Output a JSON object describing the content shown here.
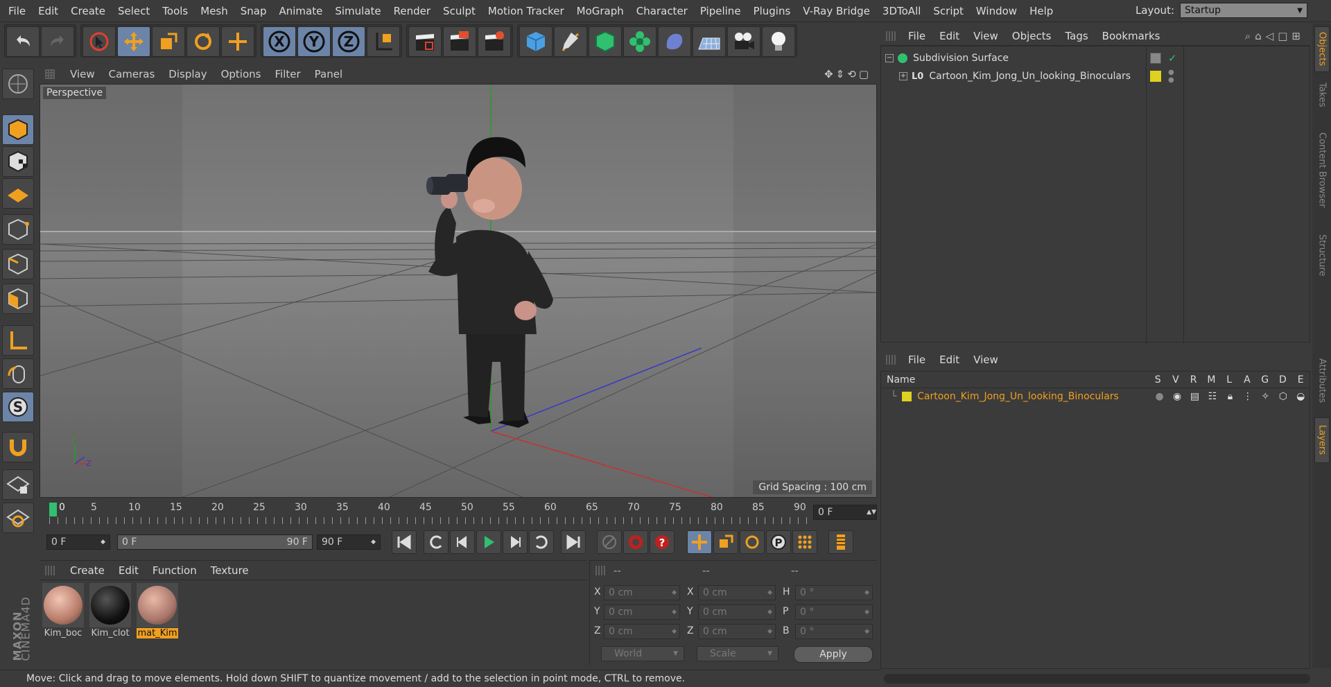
{
  "menu": [
    "File",
    "Edit",
    "Create",
    "Select",
    "Tools",
    "Mesh",
    "Snap",
    "Animate",
    "Simulate",
    "Render",
    "Sculpt",
    "Motion Tracker",
    "MoGraph",
    "Character",
    "Pipeline",
    "Plugins",
    "V-Ray Bridge",
    "3DToAll",
    "Script",
    "Window",
    "Help"
  ],
  "layout": {
    "label": "Layout:",
    "value": "Startup"
  },
  "viewport": {
    "menu": [
      "View",
      "Cameras",
      "Display",
      "Options",
      "Filter",
      "Panel"
    ],
    "camera": "Perspective",
    "grid_spacing": "Grid Spacing : 100 cm"
  },
  "axes": {
    "y": "Y",
    "z": "Z"
  },
  "timeline": {
    "ticks": [
      "0",
      "5",
      "10",
      "15",
      "20",
      "25",
      "30",
      "35",
      "40",
      "45",
      "50",
      "55",
      "60",
      "65",
      "70",
      "75",
      "80",
      "85",
      "90"
    ],
    "current": "0 F"
  },
  "transport": {
    "start": "0 F",
    "range_start": "0 F",
    "range_end": "90 F",
    "end": "90 F"
  },
  "materials": {
    "menu": [
      "Create",
      "Edit",
      "Function",
      "Texture"
    ],
    "items": [
      {
        "name": "Kim_boc",
        "color": "#d9a28e"
      },
      {
        "name": "Kim_clot",
        "color": "#1a1a1a"
      },
      {
        "name": "mat_Kim",
        "color": "#c99582"
      }
    ]
  },
  "coordinates": {
    "headers": [
      "--",
      "--",
      "--"
    ],
    "rows": [
      {
        "l1": "X",
        "v1": "0 cm",
        "l2": "X",
        "v2": "0 cm",
        "l3": "H",
        "v3": "0 °"
      },
      {
        "l1": "Y",
        "v1": "0 cm",
        "l2": "Y",
        "v2": "0 cm",
        "l3": "P",
        "v3": "0 °"
      },
      {
        "l1": "Z",
        "v1": "0 cm",
        "l2": "Z",
        "v2": "0 cm",
        "l3": "B",
        "v3": "0 °"
      }
    ],
    "mode": "World",
    "scale": "Scale",
    "apply": "Apply"
  },
  "status": "Move: Click and drag to move elements. Hold down SHIFT to quantize movement / add to the selection in point mode, CTRL to remove.",
  "logo": {
    "brand": "MAXON",
    "product": "CINEMA4D"
  },
  "objects": {
    "menu": [
      "File",
      "Edit",
      "View",
      "Objects",
      "Tags",
      "Bookmarks"
    ],
    "items": [
      {
        "name": "Subdivision Surface"
      },
      {
        "name": "Cartoon_Kim_Jong_Un_looking_Binoculars",
        "layer": "L0"
      }
    ]
  },
  "layers": {
    "menu": [
      "File",
      "Edit",
      "View"
    ],
    "columns": {
      "name": "Name",
      "flags": [
        "S",
        "V",
        "R",
        "M",
        "L",
        "A",
        "G",
        "D",
        "E"
      ]
    },
    "items": [
      {
        "name": "Cartoon_Kim_Jong_Un_looking_Binoculars"
      }
    ]
  },
  "side_tabs": [
    "Objects",
    "Takes",
    "Content Browser",
    "Structure",
    "Attributes",
    "Layers"
  ],
  "colors": {
    "accent_orange": "#f0a020",
    "active_blue": "#6c84a8",
    "layer_yellow": "#e0d020"
  }
}
